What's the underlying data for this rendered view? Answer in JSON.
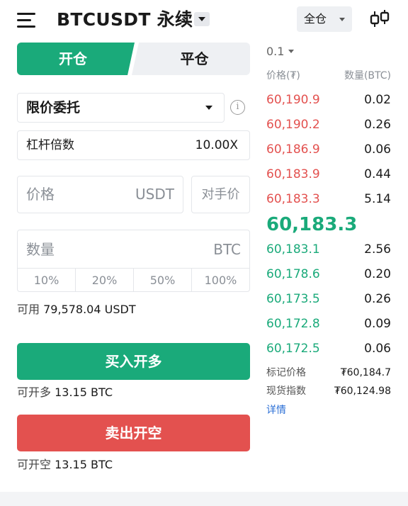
{
  "header": {
    "title": "BTCUSDT 永续",
    "margin_mode": "全仓"
  },
  "tabs": {
    "open": "开仓",
    "close": "平仓"
  },
  "order_form": {
    "order_type": "限价委托",
    "leverage_label": "杠杆倍数",
    "leverage_value": "10.00X",
    "price_placeholder": "价格",
    "price_unit": "USDT",
    "counterparty_label": "对手价",
    "quantity_placeholder": "数量",
    "quantity_unit": "BTC",
    "percent_options": [
      "10%",
      "20%",
      "50%",
      "100%"
    ],
    "available_label": "可用",
    "available_value": "79,578.04 USDT",
    "buy_button": "买入开多",
    "can_long_label": "可开多",
    "can_long_value": "13.15 BTC",
    "sell_button": "卖出开空",
    "can_short_label": "可开空",
    "can_short_value": "13.15 BTC"
  },
  "order_book": {
    "depth": "0.1",
    "price_header": "价格(₮)",
    "qty_header": "数量(BTC)",
    "asks": [
      {
        "price": "60,190.9",
        "qty": "0.02"
      },
      {
        "price": "60,190.2",
        "qty": "0.26"
      },
      {
        "price": "60,186.9",
        "qty": "0.06"
      },
      {
        "price": "60,183.9",
        "qty": "0.44"
      },
      {
        "price": "60,183.3",
        "qty": "5.14"
      }
    ],
    "last_price": "60,183.3",
    "bids": [
      {
        "price": "60,183.1",
        "qty": "2.56"
      },
      {
        "price": "60,178.6",
        "qty": "0.20"
      },
      {
        "price": "60,173.5",
        "qty": "0.26"
      },
      {
        "price": "60,172.8",
        "qty": "0.09"
      },
      {
        "price": "60,172.5",
        "qty": "0.06"
      }
    ],
    "mark_price_label": "标记价格",
    "mark_price_value": "₮60,184.7",
    "spot_index_label": "现货指数",
    "spot_index_value": "₮60,124.98",
    "details_link": "详情"
  },
  "colors": {
    "buy": "#1aaa7a",
    "sell": "#e3514f",
    "link": "#2b6fd6"
  },
  "icons": {
    "menu": "menu-icon",
    "title_dropdown": "caret-down-icon",
    "info": "info-icon",
    "chart": "candlestick-icon"
  }
}
